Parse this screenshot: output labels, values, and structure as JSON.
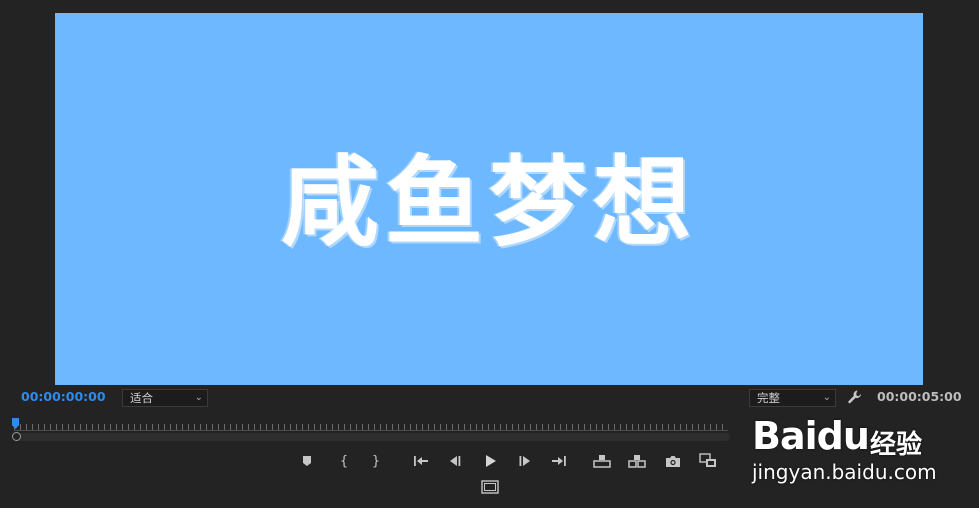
{
  "program": {
    "overlay_title": "咸鱼梦想",
    "background_color": "#6db8ff"
  },
  "timecode": {
    "current": "00:00:00:00",
    "duration": "00:00:05:00",
    "current_color": "#2d8ceb"
  },
  "zoom": {
    "selected": "适合"
  },
  "quality": {
    "selected": "完整"
  },
  "controls": [
    {
      "name": "add-marker-button",
      "icon": "marker-icon"
    },
    {
      "name": "mark-in-button",
      "icon": "mark-in-icon",
      "glyph": "{"
    },
    {
      "name": "mark-out-button",
      "icon": "mark-out-icon",
      "glyph": "}"
    },
    {
      "name": "go-to-in-button",
      "icon": "go-to-in-icon"
    },
    {
      "name": "step-back-button",
      "icon": "step-back-icon"
    },
    {
      "name": "play-button",
      "icon": "play-icon"
    },
    {
      "name": "step-forward-button",
      "icon": "step-forward-icon"
    },
    {
      "name": "go-to-out-button",
      "icon": "go-to-out-icon"
    },
    {
      "name": "lift-button",
      "icon": "lift-icon"
    },
    {
      "name": "extract-button",
      "icon": "extract-icon"
    },
    {
      "name": "export-frame-button",
      "icon": "camera-icon"
    },
    {
      "name": "compare-view-button",
      "icon": "compare-icon"
    },
    {
      "name": "safe-margins-button",
      "icon": "safe-margins-icon"
    }
  ],
  "watermark": {
    "brand": "Baidu",
    "brand_cn": "经验",
    "url": "jingyan.baidu.com"
  }
}
